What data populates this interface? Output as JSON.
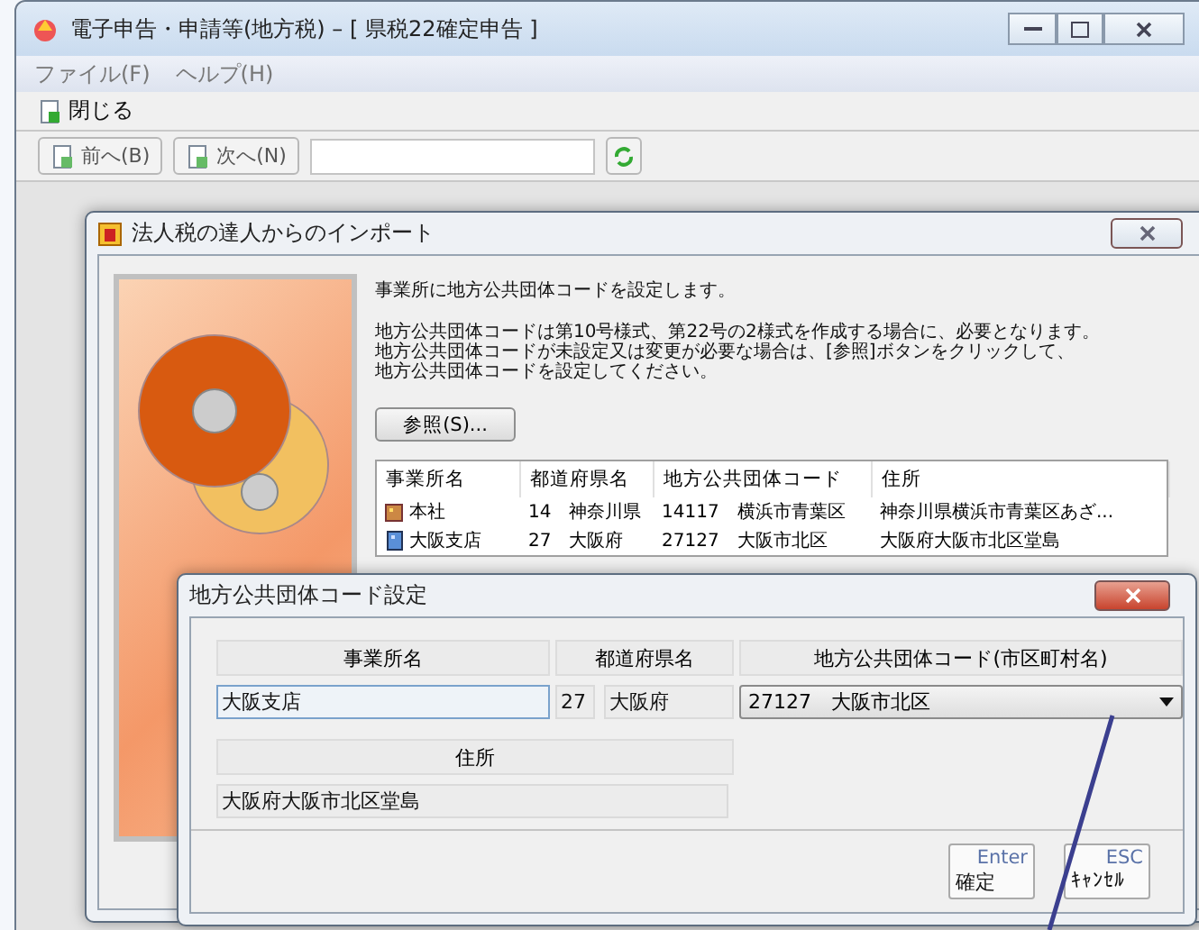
{
  "main_window": {
    "title": "電子申告・申請等(地方税) – [ 県税22確定申告 ]",
    "menu": [
      "ファイル(F)",
      "ヘルプ(H)"
    ],
    "toolbar": {
      "close_button": "閉じる"
    },
    "nav": {
      "prev_button": "前へ(B)",
      "next_button": "次へ(N)"
    }
  },
  "import_dialog": {
    "title": "法人税の達人からのインポート",
    "intro": "事業所に地方公共団体コードを設定します。",
    "description": [
      "地方公共団体コードは第10号様式、第22号の2様式を作成する場合に、必要となります。",
      "地方公共団体コードが未設定又は変更が必要な場合は、[参照]ボタンをクリックして、",
      "地方公共団体コードを設定してください。"
    ],
    "browse_button": "参照(S)...",
    "table": {
      "columns": [
        "事業所名",
        "都道府県名",
        "地方公共団体コード",
        "住所"
      ],
      "rows": [
        {
          "kind": "head",
          "cells": [
            "本社",
            "14　神奈川県",
            "14117　横浜市青葉区",
            "神奈川県横浜市青葉区あざ..."
          ]
        },
        {
          "kind": "branch",
          "cells": [
            "大阪支店",
            "27　大阪府",
            "27127　大阪市北区",
            "大阪府大阪市北区堂島"
          ]
        }
      ]
    }
  },
  "code_dialog": {
    "title": "地方公共団体コード設定",
    "office_label": "事業所名",
    "office_value": "大阪支店",
    "pref_label": "都道府県名",
    "pref_code": "27",
    "pref_name": "大阪府",
    "code_label": "地方公共団体コード(市区町村名)",
    "code_value": "27127　大阪市北区",
    "address_label": "住所",
    "address_value": "大阪府大阪市北区堂島",
    "buttons": [
      {
        "key": "Enter",
        "label": "確定"
      },
      {
        "key": "ESC",
        "label": "ｷｬﾝｾﾙ"
      }
    ]
  }
}
